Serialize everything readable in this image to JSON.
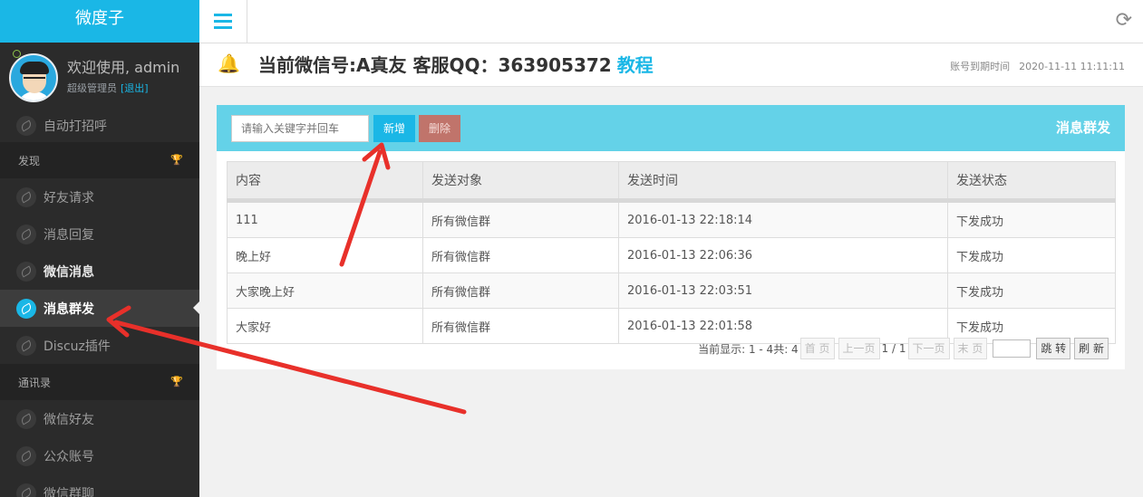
{
  "sidebar": {
    "brand": "微度子",
    "welcome": "欢迎使用, admin",
    "role": "超级管理员",
    "logout": "[退出]",
    "top_item": "自动打招呼",
    "sections": [
      {
        "title": "发现",
        "items": [
          "好友请求",
          "消息回复",
          "微信消息",
          "消息群发",
          "Discuz插件"
        ]
      },
      {
        "title": "通讯录",
        "items": [
          "微信好友",
          "公众账号",
          "微信群聊"
        ]
      }
    ],
    "active_item": "消息群发"
  },
  "header": {
    "title": "当前微信号:A真友 客服QQ：363905372",
    "tutorial_link": "教程",
    "expire_label": "账号到期时间",
    "expire_value": "2020-11-11 11:11:11"
  },
  "toolbar": {
    "search_placeholder": "请输入关键字并回车",
    "add_label": "新增",
    "delete_label": "删除",
    "panel_title": "消息群发"
  },
  "table": {
    "columns": [
      "内容",
      "发送对象",
      "发送时间",
      "发送状态"
    ],
    "rows": [
      [
        "111",
        "所有微信群",
        "2016-01-13 22:18:14",
        "下发成功"
      ],
      [
        "晚上好",
        "所有微信群",
        "2016-01-13 22:06:36",
        "下发成功"
      ],
      [
        "大家晚上好",
        "所有微信群",
        "2016-01-13 22:03:51",
        "下发成功"
      ],
      [
        "大家好",
        "所有微信群",
        "2016-01-13 22:01:58",
        "下发成功"
      ]
    ]
  },
  "pager": {
    "summary": "当前显示: 1 - 4共: 4",
    "first": "首 页",
    "prev": "上一页",
    "page_info": "1 / 1",
    "next": "下一页",
    "last": "末 页",
    "jump": "跳 转",
    "refresh": "刷 新"
  },
  "colors": {
    "accent": "#1ab7e6",
    "panel_head": "#64d2e8",
    "delete": "#c0746b",
    "sidebar": "#2b2b2b",
    "arrow": "#e8302a"
  }
}
